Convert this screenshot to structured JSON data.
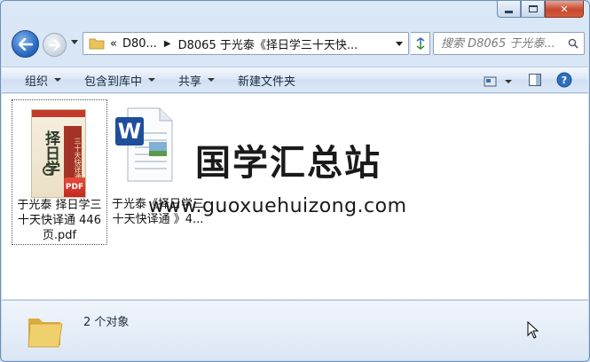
{
  "window": {
    "caption_buttons": [
      "minimize",
      "maximize",
      "close"
    ]
  },
  "address_bar": {
    "overflow": "«",
    "crumbs": [
      "D80...",
      "D8065 于光泰《择日学三十天快..."
    ]
  },
  "search": {
    "placeholder": "搜索 D8065 于光泰..."
  },
  "toolbar": {
    "organize": "组织",
    "include_in_library": "包含到库中",
    "share": "共享",
    "new_folder": "新建文件夹"
  },
  "files": [
    {
      "name": "于光泰 择日学三十天快译通 446页.pdf",
      "label_lines": [
        "于光泰 择日学三",
        "十天快译通 446",
        "页.pdf"
      ],
      "type": "pdf",
      "thumb_title": "择日学",
      "thumb_subtitle": "三十天快译通"
    },
    {
      "name": "于光泰《择日学三十天快译通 》4...",
      "label_lines": [
        "于光泰《择日学三",
        "十天快译通 》4..."
      ],
      "type": "word"
    }
  ],
  "watermark": {
    "text": "国学汇总站",
    "url": "www.guoxuehuizong.com"
  },
  "details": {
    "count_text": "2 个对象"
  },
  "colors": {
    "close": "#c7482e",
    "accent": "#2d6bc2",
    "word_blue": "#1f4e9c",
    "pdf_red": "#d8372b"
  }
}
